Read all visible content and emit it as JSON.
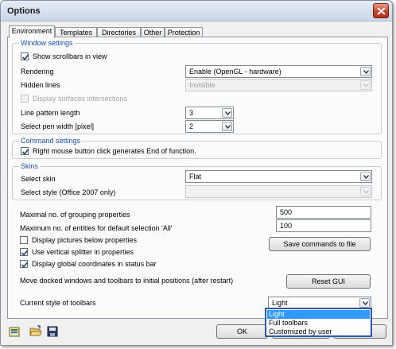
{
  "window": {
    "title": "Options"
  },
  "tabs": [
    {
      "label": "Environment",
      "active": true
    },
    {
      "label": "Templates",
      "active": false
    },
    {
      "label": "Directories",
      "active": false
    },
    {
      "label": "Other",
      "active": false
    },
    {
      "label": "Protection",
      "active": false
    }
  ],
  "window_settings": {
    "legend": "Window settings",
    "show_scrollbars_label": "Show scrollbars in view",
    "show_scrollbars_checked": true,
    "rendering_label": "Rendering",
    "rendering_value": "Enable (OpenGL - hardware)",
    "hidden_lines_label": "Hidden lines",
    "hidden_lines_value": "Invisible",
    "display_surfaces_label": "Display surfaces intersections",
    "display_surfaces_checked": false,
    "line_pattern_label": "Line pattern length",
    "line_pattern_value": "3",
    "pen_width_label": "Select pen width [pixel]",
    "pen_width_value": "2"
  },
  "command_settings": {
    "legend": "Command settings",
    "right_click_label": "Right mouse button click generates End of function.",
    "right_click_checked": true
  },
  "skins": {
    "legend": "Skins",
    "skin_label": "Select skin",
    "skin_value": "Flat",
    "style_label": "Select style (Office 2007 only)",
    "style_value": ""
  },
  "misc": {
    "grouping_label": "Maximal no. of grouping properties",
    "grouping_value": "500",
    "entities_label": "Maximum no. of entities for default selection 'All'",
    "entities_value": "100",
    "display_pictures_label": "Display pictures below properties",
    "display_pictures_checked": false,
    "save_commands_label": "Save commands to file",
    "vertical_splitter_label": "Use vertical splitter in properties",
    "vertical_splitter_checked": true,
    "global_coords_label": "Display global coordinates in status bar",
    "global_coords_checked": true,
    "move_docked_label": "Move docked windows and toolbars to initial positions (after restart)",
    "reset_gui_label": "Reset GUI",
    "toolbar_style_label": "Current style of toolbars",
    "toolbar_style_value": "Light",
    "toolbar_style_options": [
      "Light",
      "Full toolbars",
      "Customized by user"
    ],
    "toolbar_style_highlighted": "Light"
  },
  "footer": {
    "ok_label": "OK",
    "icons": [
      "load-settings-icon",
      "open-folder-icon",
      "save-disk-icon"
    ]
  },
  "colors": {
    "group_legend": "#1a4fa8",
    "selection": "#3399ff",
    "close_button": "#c4452b"
  }
}
